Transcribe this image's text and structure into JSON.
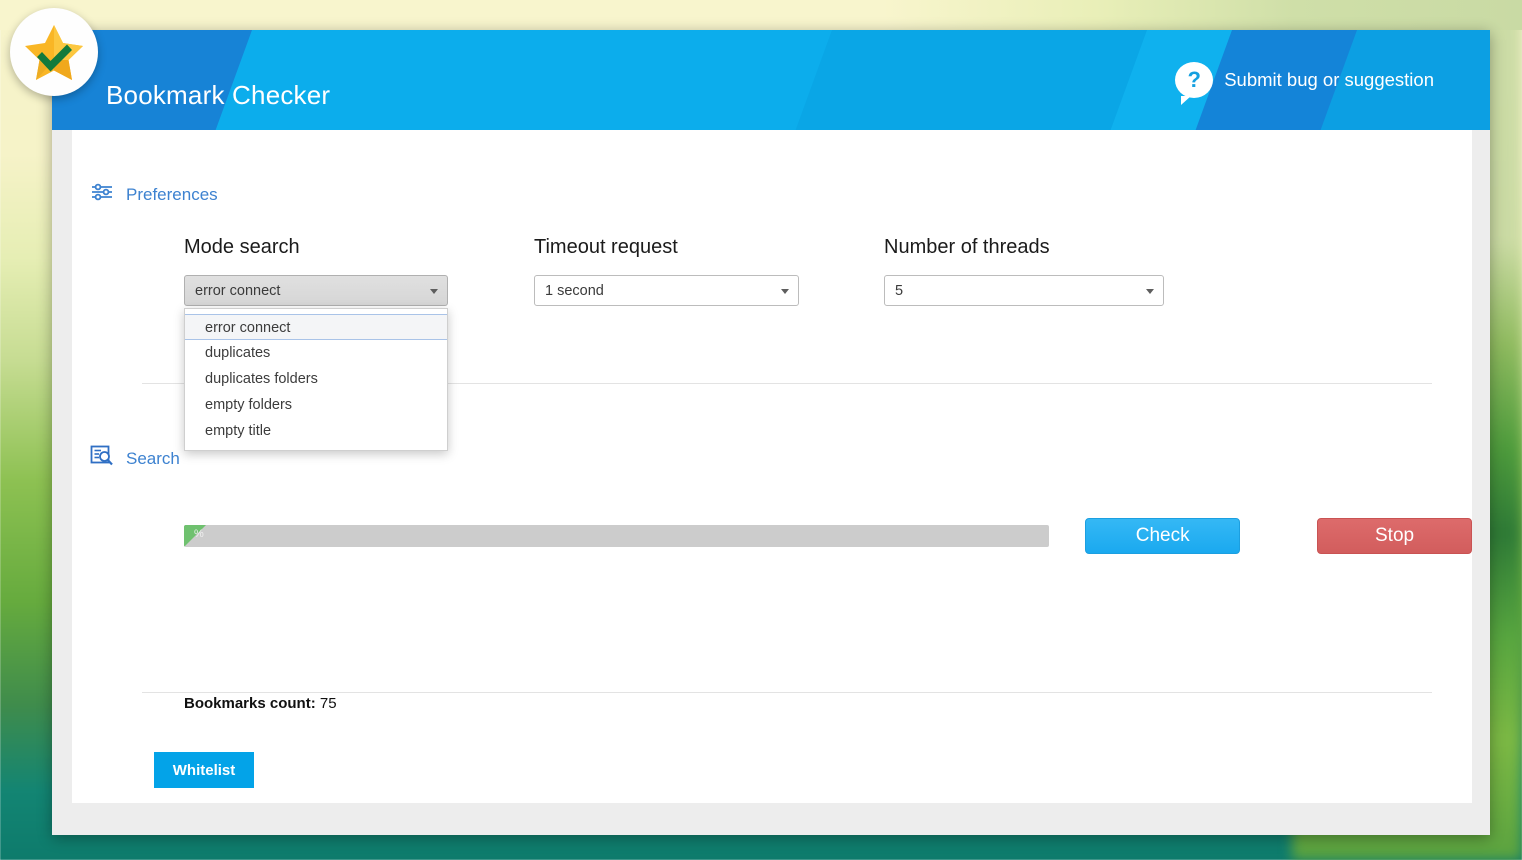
{
  "header": {
    "title": "Bookmark Checker",
    "logo_icon": "star-check-logo",
    "submit_bug": {
      "label": "Submit bug or suggestion",
      "icon": "question-bubble-icon"
    }
  },
  "preferences": {
    "section_label": "Preferences",
    "section_icon": "tune-sliders-icon",
    "fields": [
      {
        "label": "Mode search",
        "value": "error connect",
        "name": "mode-search",
        "open": true,
        "options": [
          "error connect",
          "duplicates",
          "duplicates folders",
          "empty folders",
          "empty title"
        ]
      },
      {
        "label": "Timeout request",
        "value": "1 second",
        "name": "timeout-request",
        "open": false,
        "options": [
          "1 second"
        ]
      },
      {
        "label": "Number of threads",
        "value": "5",
        "name": "number-of-threads",
        "open": false,
        "options": [
          "5"
        ]
      }
    ]
  },
  "search": {
    "section_label": "Search",
    "section_icon": "page-search-icon",
    "progress": {
      "percent_text": "%",
      "percent_value": 2
    },
    "check_label": "Check",
    "stop_label": "Stop",
    "bookmarks_count_label": "Bookmarks count:",
    "bookmarks_count_value": "75"
  },
  "footer": {
    "whitelist_label": "Whitelist"
  },
  "colors": {
    "accent_blue": "#0fa7e8",
    "header_dark_blue": "#1783d6",
    "check_blue": "#1aa9ef",
    "stop_red": "#d25d5d",
    "whitelist_blue": "#03a3e8",
    "progress_green": "#6fc16f",
    "section_link": "#3d82d0"
  }
}
